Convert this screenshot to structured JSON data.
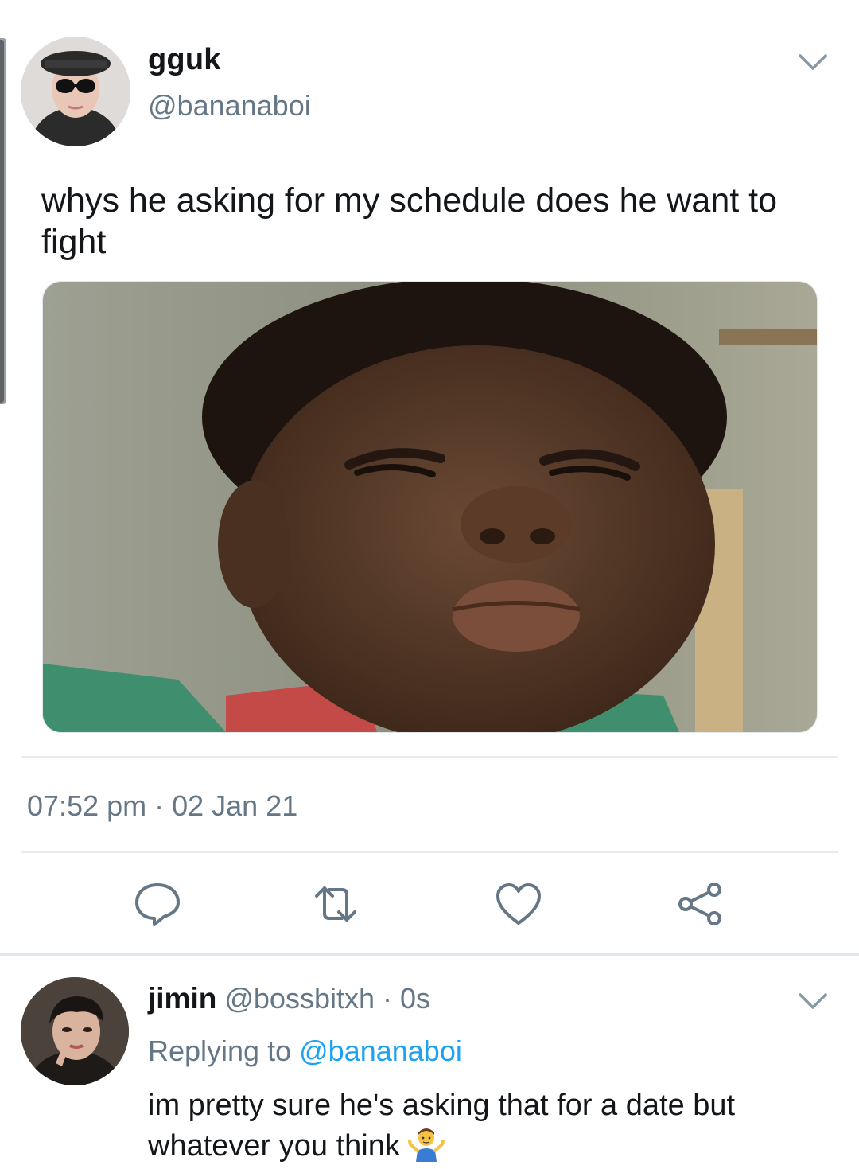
{
  "tweet": {
    "name": "gguk",
    "handle": "@bananaboi",
    "text": "whys he asking for my schedule does he want to fight",
    "time": "07:52 pm",
    "separator": " · ",
    "date": "02 Jan 21"
  },
  "actions": {
    "reply_icon": "reply-icon",
    "retweet_icon": "retweet-icon",
    "like_icon": "heart-icon",
    "share_icon": "share-icon"
  },
  "reply": {
    "name": "jimin",
    "handle": "@bossbitxh",
    "time": "· 0s",
    "replying_prefix": "Replying to",
    "replying_to": "@bananaboi",
    "text": "im pretty sure he's asking that for a date but whatever you think"
  },
  "colors": {
    "accent": "#1da1f2",
    "secondary_text": "#657786",
    "primary_text": "#14171a",
    "icon": "#657786"
  }
}
